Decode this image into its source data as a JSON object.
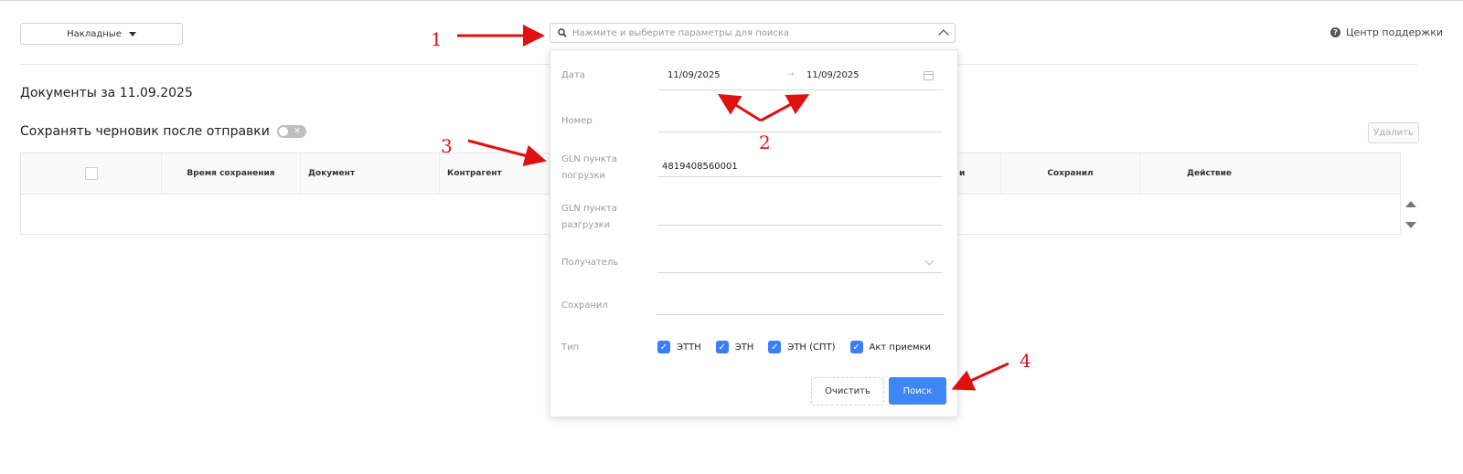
{
  "header": {
    "docs_dropdown": "Накладные",
    "search_placeholder": "Нажмите и выберите параметры для поиска",
    "support_link": "Центр поддержки"
  },
  "main": {
    "docs_title": "Документы за 11.09.2025",
    "save_draft_label": "Сохранять черновик после отправки",
    "delete_label": "Удалить",
    "columns": [
      "Время сохранения",
      "Документ",
      "Контрагент",
      "и",
      "Сохранил",
      "Действие"
    ]
  },
  "search_panel": {
    "date_label": "Дата",
    "date_from": "11/09/2025",
    "date_to": "11/09/2025",
    "date_arrow": "→",
    "number_label": "Номер",
    "gln_load_label_1": "GLN пункта",
    "gln_load_label_2": "погрузки",
    "gln_load_value": "4819408560001",
    "gln_unload_label_1": "GLN пункта",
    "gln_unload_label_2": "разгрузки",
    "recipient_label": "Получатель",
    "saved_by_label": "Сохранил",
    "type_label": "Тип",
    "types": [
      "ЭТТН",
      "ЭТН",
      "ЭТН (СПТ)",
      "Акт приемки"
    ],
    "clear_button": "Очистить",
    "search_button": "Поиск"
  },
  "annotations": {
    "n1": "1",
    "n2": "2",
    "n3": "3",
    "n4": "4",
    "color": "#e01010"
  },
  "colors": {
    "primary": "#3e85f8",
    "checkbox": "#3b7ef7"
  }
}
